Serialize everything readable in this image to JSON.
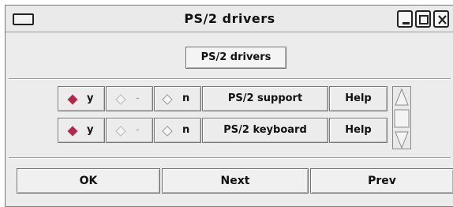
{
  "window": {
    "title": "PS/2 drivers"
  },
  "header_button": "PS/2 drivers",
  "rows": [
    {
      "opt_y": "y",
      "opt_m": "-",
      "opt_n": "n",
      "label": "PS/2 support",
      "help": "Help",
      "selected": "y"
    },
    {
      "opt_y": "y",
      "opt_m": "-",
      "opt_n": "n",
      "label": "PS/2 keyboard",
      "help": "Help",
      "selected": "y"
    }
  ],
  "footer": {
    "ok": "OK",
    "next": "Next",
    "prev": "Prev"
  },
  "colors": {
    "selected_radio": "#b0284a",
    "window_bg": "#ececec"
  },
  "icons": [
    "window-menu-icon",
    "minimize-icon",
    "maximize-icon",
    "close-icon",
    "scroll-up-icon",
    "scroll-down-icon"
  ]
}
